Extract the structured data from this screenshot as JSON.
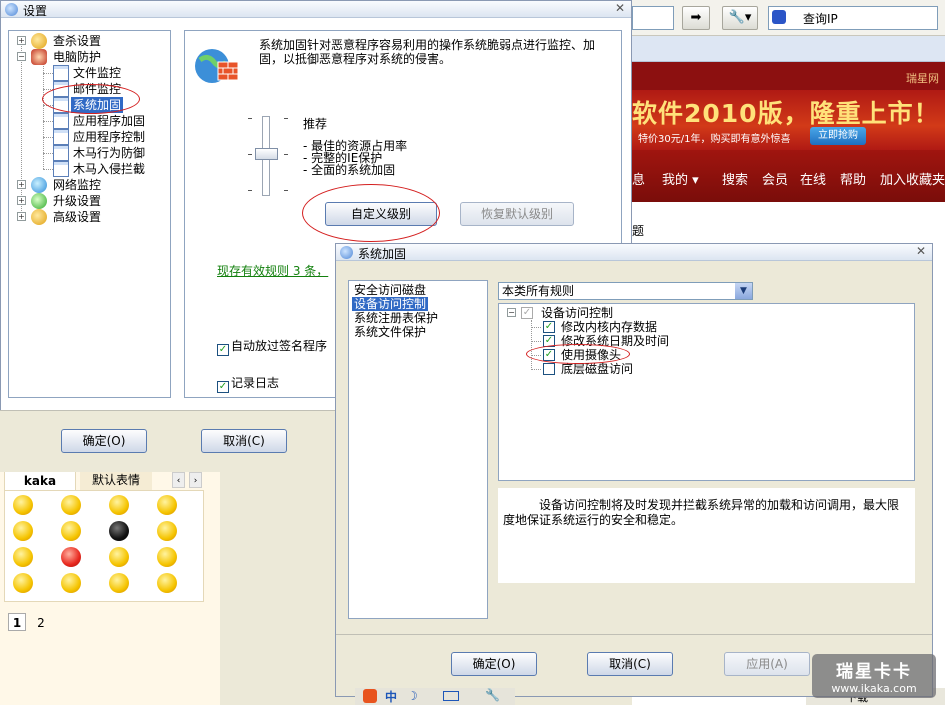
{
  "browser": {
    "search_placeholder": "查询IP",
    "brand_text": "瑞星网",
    "banner_title": "软件2010版，隆重上市！",
    "banner_subtitle": "特价30元/1年，购买即有意外惊喜",
    "banner_button": "立即抢购",
    "nav_items": [
      "息",
      "我的 ▾",
      "搜索",
      "会员",
      "在线",
      "帮助",
      "加入收藏夹"
    ],
    "page_snippet": "题",
    "tray_text": "下载"
  },
  "emoticons": {
    "tabs": [
      "kaka",
      "默认表情"
    ],
    "pages": [
      "1",
      "2"
    ]
  },
  "settings": {
    "title": "设置",
    "tree": {
      "virus_settings": "查杀设置",
      "pc_protection": "电脑防护",
      "file_monitor": "文件监控",
      "mail_monitor": "邮件监控",
      "system_hardening": "系统加固",
      "app_hardening": "应用程序加固",
      "app_control": "应用程序控制",
      "trojan_defense": "木马行为防御",
      "trojan_intercept": "木马入侵拦截",
      "network_monitor": "网络监控",
      "upgrade_settings": "升级设置",
      "advanced_settings": "高级设置"
    },
    "description": "系统加固针对恶意程序容易利用的操作系统脆弱点进行监控、加固，以抵御恶意程序对系统的侵害。",
    "level_name": "推荐",
    "features": [
      "最佳的资源占用率",
      "完整的IE保护",
      "全面的系统加固"
    ],
    "custom_level_button": "自定义级别",
    "restore_default_button": "恢复默认级别",
    "rules_text": "现存有效规则 3 条，",
    "auto_allow_signed": "自动放过签名程序",
    "log_record": "记录日志",
    "ok_button": "确定(O)",
    "cancel_button": "取消(C)"
  },
  "dialog": {
    "title": "系统加固",
    "categories": [
      "安全访问磁盘",
      "设备访问控制",
      "系统注册表保护",
      "系统文件保护"
    ],
    "selected_category": "设备访问控制",
    "filter_value": "本类所有规则",
    "tree_root": "设备访问控制",
    "rules": [
      {
        "label": "修改内核内存数据",
        "checked": true
      },
      {
        "label": "修改系统日期及时间",
        "checked": true
      },
      {
        "label": "使用摄像头",
        "checked": true
      },
      {
        "label": "底层磁盘访问",
        "checked": false
      }
    ],
    "description": "设备访问控制将及时发现并拦截系统异常的加载和访问调用，最大限度地保证系统运行的安全和稳定。",
    "ok_button": "确定(O)",
    "cancel_button": "取消(C)",
    "apply_button": "应用(A)"
  },
  "taskbar": {
    "ime_label": "中"
  },
  "watermark": {
    "main": "瑞星卡卡",
    "sub": "www.ikaka.com"
  }
}
